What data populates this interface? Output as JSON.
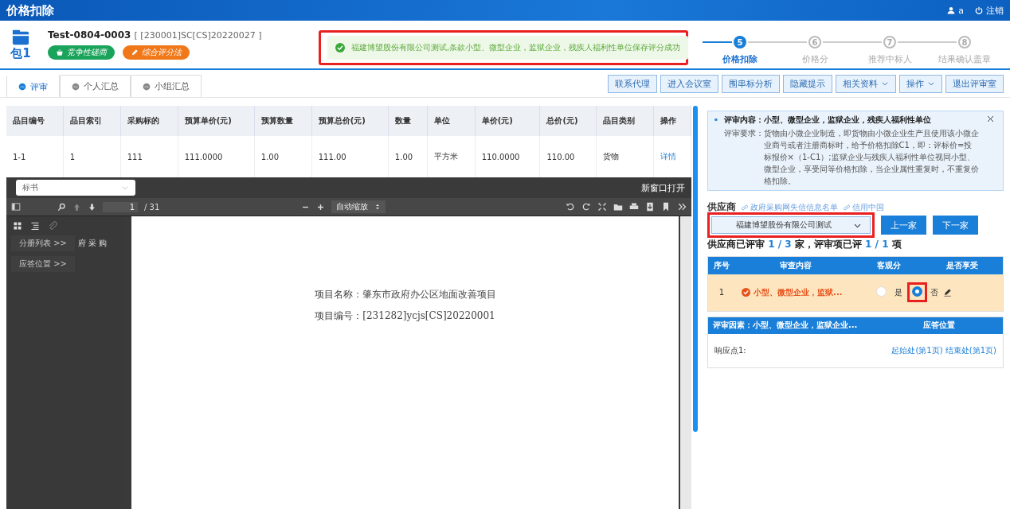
{
  "window": {
    "title": "价格扣除"
  },
  "user": {
    "name": "a",
    "logout": "注销"
  },
  "package": {
    "label": "包1",
    "code": "Test-0804-0003",
    "ref": "[ [230001]SC[CS]20220027 ]",
    "tags": [
      {
        "text": "竞争性磋商",
        "color": "#1aa35a"
      },
      {
        "text": "综合评分法",
        "color": "#f07818"
      }
    ]
  },
  "steps": [
    {
      "number": "5",
      "label": "价格扣除",
      "selected": true
    },
    {
      "number": "6",
      "label": "价格分",
      "selected": false
    },
    {
      "number": "7",
      "label": "推荐中标人",
      "selected": false
    },
    {
      "number": "8",
      "label": "结果确认盖章",
      "selected": false
    }
  ],
  "toast": {
    "text": "福建博望股份有限公司测试,条款小型、微型企业，监狱企业，残疾人福利性单位保存评分成功",
    "highlighted": true
  },
  "tabs": [
    {
      "label": "评审",
      "selected": true
    },
    {
      "label": "个人汇总",
      "selected": false
    },
    {
      "label": "小组汇总",
      "selected": false
    }
  ],
  "actions": [
    {
      "label": "联系代理",
      "dropdown": false
    },
    {
      "label": "进入会议室",
      "dropdown": false
    },
    {
      "label": "围串标分析",
      "dropdown": false
    },
    {
      "label": "隐藏提示",
      "dropdown": false
    },
    {
      "label": "相关资料",
      "dropdown": true
    },
    {
      "label": "操作",
      "dropdown": true
    },
    {
      "label": "退出评审室",
      "dropdown": false
    }
  ],
  "table": {
    "columns": [
      "品目编号",
      "品目索引",
      "采购标的",
      "预算单价(元)",
      "预算数量",
      "预算总价(元)",
      "数量",
      "单位",
      "单价(元)",
      "总价(元)",
      "品目类别",
      "操作"
    ],
    "rows": [
      [
        "1-1",
        "1",
        "111",
        "111.0000",
        "1.00",
        "111.00",
        "1.00",
        "平方米",
        "110.0000",
        "110.00",
        "货物",
        "详情"
      ]
    ]
  },
  "viewer": {
    "document": "标书",
    "open_new": "新窗口打开",
    "page": "1",
    "pages": "/ 31",
    "zoom": "自动缩放",
    "sidebar_items": [
      "分册列表 >>",
      "应答位置 >>"
    ],
    "sidebar_fragment": "府 采 购",
    "lines": [
      "项目名称：肇东市政府办公区地面改善项目",
      "项目编号：[231282]ycjs[CS]20220001"
    ]
  },
  "info": {
    "title": "评审内容：小型、微型企业，监狱企业，残疾人福利性单位",
    "req_label": "评审要求：",
    "requirement": "货物由小微企业制造，即货物由小微企业生产且使用该小微企业商号或者注册商标时，给予价格扣除C1，即：评标价=投标报价×（1-C1）;监狱企业与残疾人福利性单位视同小型、微型企业，享受同等价格扣除，当企业属性重复时，不重复价格扣除。"
  },
  "supplier": {
    "label": "供应商",
    "links": [
      "政府采购网失信信息名单",
      "信用中国"
    ],
    "selected": "福建博望股份有限公司测试",
    "highlighted": true,
    "prev": "上一家",
    "next": "下一家"
  },
  "progress": {
    "text1": "供应商已评审 ",
    "s_done": "1",
    "s_sep": " / ",
    "s_total": "3",
    "text2": " 家，评审项已评 ",
    "i_done": "1",
    "i_sep": " / ",
    "i_total": "1",
    "text3": " 项"
  },
  "review": {
    "columns": [
      "序号",
      "审查内容",
      "客观分",
      "是否享受"
    ],
    "rows": [
      {
        "no": "1",
        "content": "小型、微型企业，监狱...",
        "options": [
          {
            "label": "是",
            "selected": false
          },
          {
            "label": "否",
            "selected": true
          }
        ]
      }
    ]
  },
  "factor": {
    "columns": [
      "评审因素：小型、微型企业，监狱企业...",
      "应答位置"
    ],
    "rows": [
      {
        "point": "响应点1:",
        "start": "起始处(第1页)",
        "end": "结束处(第1页)"
      }
    ]
  }
}
